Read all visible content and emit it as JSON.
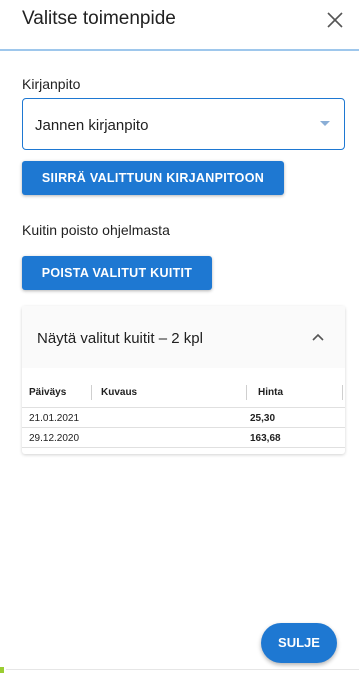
{
  "dialog": {
    "title": "Valitse toimenpide",
    "close_icon": "close-icon"
  },
  "ledger": {
    "label": "Kirjanpito",
    "selected_value": "Jannen kirjanpito",
    "dropdown_icon": "dropdown-arrow-icon",
    "move_button": "SIIRRÄ VALITTUUN KIRJANPITOON"
  },
  "deletion": {
    "label": "Kuitin poisto ohjelmasta",
    "delete_button": "POISTA VALITUT KUITIT"
  },
  "selected_receipts": {
    "title": "Näytä valitut kuitit – 2 kpl",
    "toggle_icon": "chevron-up-icon",
    "columns": [
      "Päiväys",
      "Kuvaus",
      "Hinta"
    ],
    "rows": [
      {
        "date": "21.01.2021",
        "description": "",
        "price": "25,30"
      },
      {
        "date": "29.12.2020",
        "description": "",
        "price": "163,68"
      }
    ]
  },
  "footer": {
    "close_button": "SULJE"
  },
  "colors": {
    "accent": "#1e78d2",
    "header_rule": "#9ec7ec",
    "text": "#212121"
  }
}
